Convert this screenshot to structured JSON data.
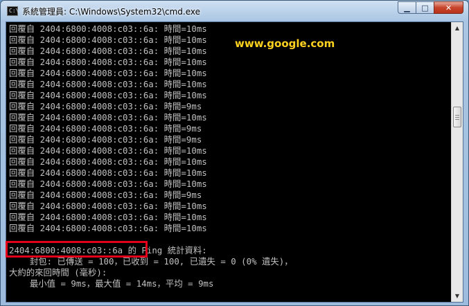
{
  "window": {
    "title": "系統管理員: C:\\Windows\\System32\\cmd.exe",
    "icon": "cmd-console-icon",
    "buttons": {
      "minimize": "▁",
      "maximize": "□",
      "close": "✕"
    }
  },
  "overlay": {
    "url_label": "www.google.com",
    "url_color": "#ffd21f",
    "highlight_color": "#e3001b"
  },
  "console": {
    "text_color": "#c0c0c0",
    "background": "#000000",
    "reply_lines": [
      "回覆自 2404:6800:4008:c03::6a: 時間=10ms",
      "回覆自 2404:6800:4008:c03::6a: 時間=10ms",
      "回覆自 2404:6800:4008:c03::6a: 時間=10ms",
      "回覆自 2404:6800:4008:c03::6a: 時間=10ms",
      "回覆自 2404:6800:4008:c03::6a: 時間=10ms",
      "回覆自 2404:6800:4008:c03::6a: 時間=10ms",
      "回覆自 2404:6800:4008:c03::6a: 時間=10ms",
      "回覆自 2404:6800:4008:c03::6a: 時間=9ms",
      "回覆自 2404:6800:4008:c03::6a: 時間=10ms",
      "回覆自 2404:6800:4008:c03::6a: 時間=9ms",
      "回覆自 2404:6800:4008:c03::6a: 時間=9ms",
      "回覆自 2404:6800:4008:c03::6a: 時間=10ms",
      "回覆自 2404:6800:4008:c03::6a: 時間=10ms",
      "回覆自 2404:6800:4008:c03::6a: 時間=10ms",
      "回覆自 2404:6800:4008:c03::6a: 時間=10ms",
      "回覆自 2404:6800:4008:c03::6a: 時間=9ms",
      "回覆自 2404:6800:4008:c03::6a: 時間=10ms",
      "回覆自 2404:6800:4008:c03::6a: 時間=10ms",
      "回覆自 2404:6800:4008:c03::6a: 時間=10ms"
    ],
    "stats_header": "2404:6800:4008:c03::6a 的 Ping 統計資料:",
    "stats_packets": "    封包: 已傳送 = 100，已收到 = 100, 已遺失 = 0 (0% 遺失)，",
    "rtt_header": "大約的來回時間 (毫秒):",
    "rtt_values": "    最小值 = 9ms，最大值 = 14ms，平均 = 9ms"
  },
  "scrollbar": {
    "up_arrow": "▲",
    "down_arrow": "▼"
  }
}
